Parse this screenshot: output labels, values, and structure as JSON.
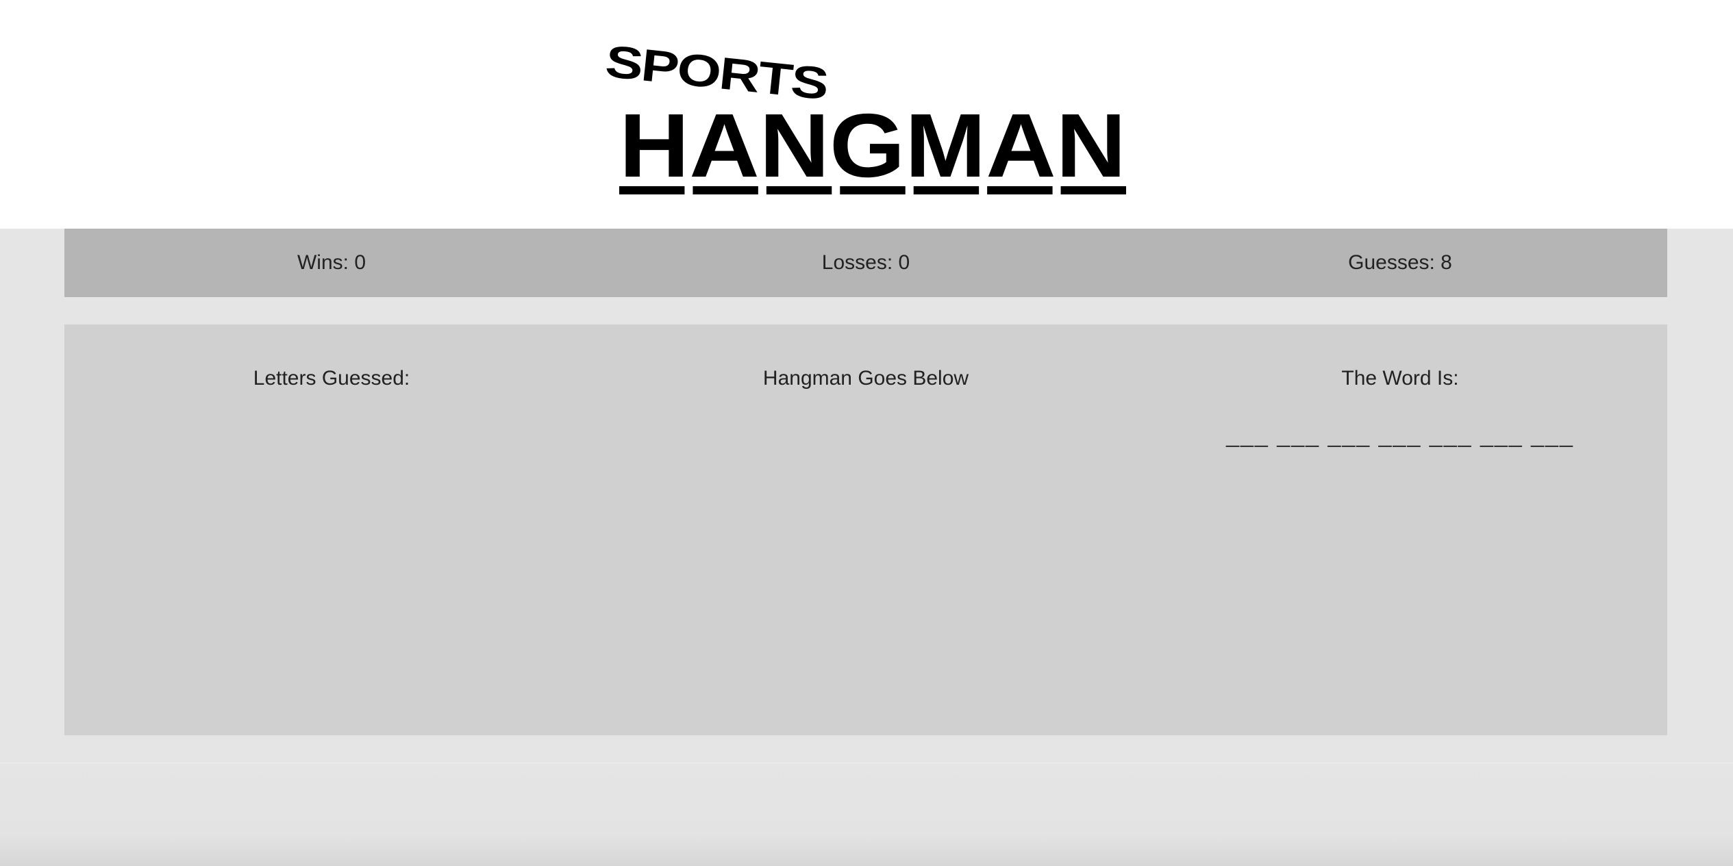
{
  "header": {
    "logo": {
      "line1": "SPORTS",
      "line2": "HANGMAN",
      "underline_count": 7
    }
  },
  "stats": {
    "wins_label": "Wins: 0",
    "losses_label": "Losses: 0",
    "guesses_label": "Guesses: 8"
  },
  "panel": {
    "letters_title": "Letters Guessed:",
    "letters_value": "",
    "hangman_title": "Hangman Goes Below",
    "word_title": "The Word Is:",
    "word_blanks": "___ ___ ___ ___ ___ ___ ___"
  },
  "colors": {
    "page_background": "#e5e5e5",
    "header_background": "#ffffff",
    "stats_background": "#b5b5b5",
    "panel_background": "#d0d0d0",
    "text": "#222222",
    "logo": "#000000"
  }
}
